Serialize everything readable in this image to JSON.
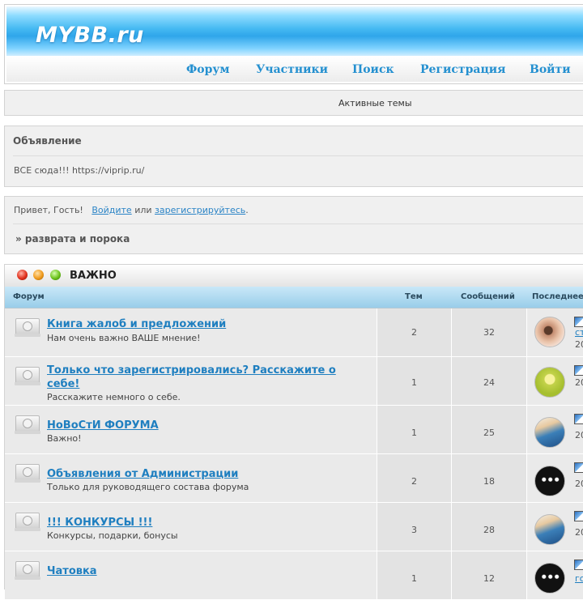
{
  "header": {
    "logo": "MYBB.ru",
    "nav": [
      "Форум",
      "Участники",
      "Поиск",
      "Регистрация",
      "Войти"
    ]
  },
  "active_topics": "Активные темы",
  "announcement": {
    "title": "Объявление",
    "text": "ВСЕ сюда!!! https://viprip.ru/"
  },
  "greeting": {
    "prefix": "Привет, Гость!",
    "login": "Войдите",
    "or": "или",
    "register": "зарегистрируйтесь",
    "suffix": ".",
    "crumb": "» разврата и порока"
  },
  "category": {
    "title": "ВАЖНО",
    "columns": [
      "Форум",
      "Тем",
      "Сообщений",
      "Последнее"
    ],
    "forums": [
      {
        "title": "Книга жалоб и предложений",
        "desc": "Нам очень важно ВАШЕ мнение!",
        "topics": "2",
        "posts": "32",
        "last_link": "ста",
        "last_date": "20",
        "avatar": "eye-avatar"
      },
      {
        "title": "Только что зарегистрировались? Расскажите о себе!",
        "desc": "Расскажите немного о себе.",
        "topics": "1",
        "posts": "24",
        "last_link": "",
        "last_date": "20",
        "avatar": "stick-figure-avatar"
      },
      {
        "title": "НоВоСтИ ФОРУМА",
        "desc": "Важно!",
        "topics": "1",
        "posts": "25",
        "last_link": "",
        "last_date": "20",
        "avatar": "wave-avatar"
      },
      {
        "title": "Объявления от Администрации",
        "desc": "Только для руководящего состава форума",
        "topics": "2",
        "posts": "18",
        "last_link": "",
        "last_date": "20",
        "avatar": "skulls-avatar"
      },
      {
        "title": "!!! КОНКУРСЫ !!!",
        "desc": "Конкурсы, подарки, бонусы",
        "topics": "3",
        "posts": "28",
        "last_link": "",
        "last_date": "20",
        "avatar": "wave-avatar"
      },
      {
        "title": "Чатовка",
        "desc": "",
        "topics": "1",
        "posts": "12",
        "last_link": "го",
        "last_date": "",
        "avatar": "skulls-avatar"
      }
    ]
  }
}
